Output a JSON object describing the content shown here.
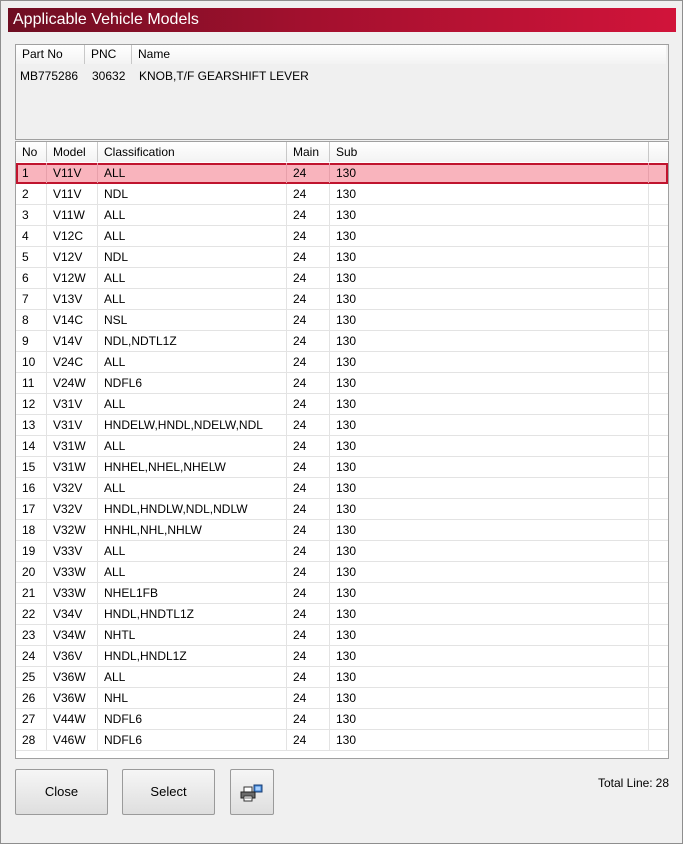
{
  "window": {
    "title": "Applicable Vehicle Models"
  },
  "part": {
    "headers": {
      "part_no": "Part No",
      "pnc": "PNC",
      "name": "Name"
    },
    "values": {
      "part_no": "MB775286",
      "pnc": "30632",
      "name": "KNOB,T/F GEARSHIFT LEVER"
    }
  },
  "table": {
    "headers": {
      "no": "No",
      "model": "Model",
      "classification": "Classification",
      "main": "Main",
      "sub": "Sub"
    },
    "rows": [
      {
        "no": "1",
        "model": "V11V",
        "classification": "ALL",
        "main": "24",
        "sub": "130"
      },
      {
        "no": "2",
        "model": "V11V",
        "classification": "NDL",
        "main": "24",
        "sub": "130"
      },
      {
        "no": "3",
        "model": "V11W",
        "classification": "ALL",
        "main": "24",
        "sub": "130"
      },
      {
        "no": "4",
        "model": "V12C",
        "classification": "ALL",
        "main": "24",
        "sub": "130"
      },
      {
        "no": "5",
        "model": "V12V",
        "classification": "NDL",
        "main": "24",
        "sub": "130"
      },
      {
        "no": "6",
        "model": "V12W",
        "classification": "ALL",
        "main": "24",
        "sub": "130"
      },
      {
        "no": "7",
        "model": "V13V",
        "classification": "ALL",
        "main": "24",
        "sub": "130"
      },
      {
        "no": "8",
        "model": "V14C",
        "classification": "NSL",
        "main": "24",
        "sub": "130"
      },
      {
        "no": "9",
        "model": "V14V",
        "classification": "NDL,NDTL1Z",
        "main": "24",
        "sub": "130"
      },
      {
        "no": "10",
        "model": "V24C",
        "classification": "ALL",
        "main": "24",
        "sub": "130"
      },
      {
        "no": "11",
        "model": "V24W",
        "classification": "NDFL6",
        "main": "24",
        "sub": "130"
      },
      {
        "no": "12",
        "model": "V31V",
        "classification": "ALL",
        "main": "24",
        "sub": "130"
      },
      {
        "no": "13",
        "model": "V31V",
        "classification": "HNDELW,HNDL,NDELW,NDL",
        "main": "24",
        "sub": "130"
      },
      {
        "no": "14",
        "model": "V31W",
        "classification": "ALL",
        "main": "24",
        "sub": "130"
      },
      {
        "no": "15",
        "model": "V31W",
        "classification": "HNHEL,NHEL,NHELW",
        "main": "24",
        "sub": "130"
      },
      {
        "no": "16",
        "model": "V32V",
        "classification": "ALL",
        "main": "24",
        "sub": "130"
      },
      {
        "no": "17",
        "model": "V32V",
        "classification": "HNDL,HNDLW,NDL,NDLW",
        "main": "24",
        "sub": "130"
      },
      {
        "no": "18",
        "model": "V32W",
        "classification": "HNHL,NHL,NHLW",
        "main": "24",
        "sub": "130"
      },
      {
        "no": "19",
        "model": "V33V",
        "classification": "ALL",
        "main": "24",
        "sub": "130"
      },
      {
        "no": "20",
        "model": "V33W",
        "classification": "ALL",
        "main": "24",
        "sub": "130"
      },
      {
        "no": "21",
        "model": "V33W",
        "classification": "NHEL1FB",
        "main": "24",
        "sub": "130"
      },
      {
        "no": "22",
        "model": "V34V",
        "classification": "HNDL,HNDTL1Z",
        "main": "24",
        "sub": "130"
      },
      {
        "no": "23",
        "model": "V34W",
        "classification": "NHTL",
        "main": "24",
        "sub": "130"
      },
      {
        "no": "24",
        "model": "V36V",
        "classification": "HNDL,HNDL1Z",
        "main": "24",
        "sub": "130"
      },
      {
        "no": "25",
        "model": "V36W",
        "classification": "ALL",
        "main": "24",
        "sub": "130"
      },
      {
        "no": "26",
        "model": "V36W",
        "classification": "NHL",
        "main": "24",
        "sub": "130"
      },
      {
        "no": "27",
        "model": "V44W",
        "classification": "NDFL6",
        "main": "24",
        "sub": "130"
      },
      {
        "no": "28",
        "model": "V46W",
        "classification": "NDFL6",
        "main": "24",
        "sub": "130"
      }
    ],
    "selected_index": 0
  },
  "buttons": {
    "close": "Close",
    "select": "Select",
    "print_icon": "printer-icon"
  },
  "footer": {
    "total_label": "Total Line:",
    "total_value": "28"
  },
  "colors": {
    "title_start": "#6e0e22",
    "title_end": "#d1143a",
    "selected_fill": "#f9b4bd",
    "selected_border": "#c0142e"
  }
}
